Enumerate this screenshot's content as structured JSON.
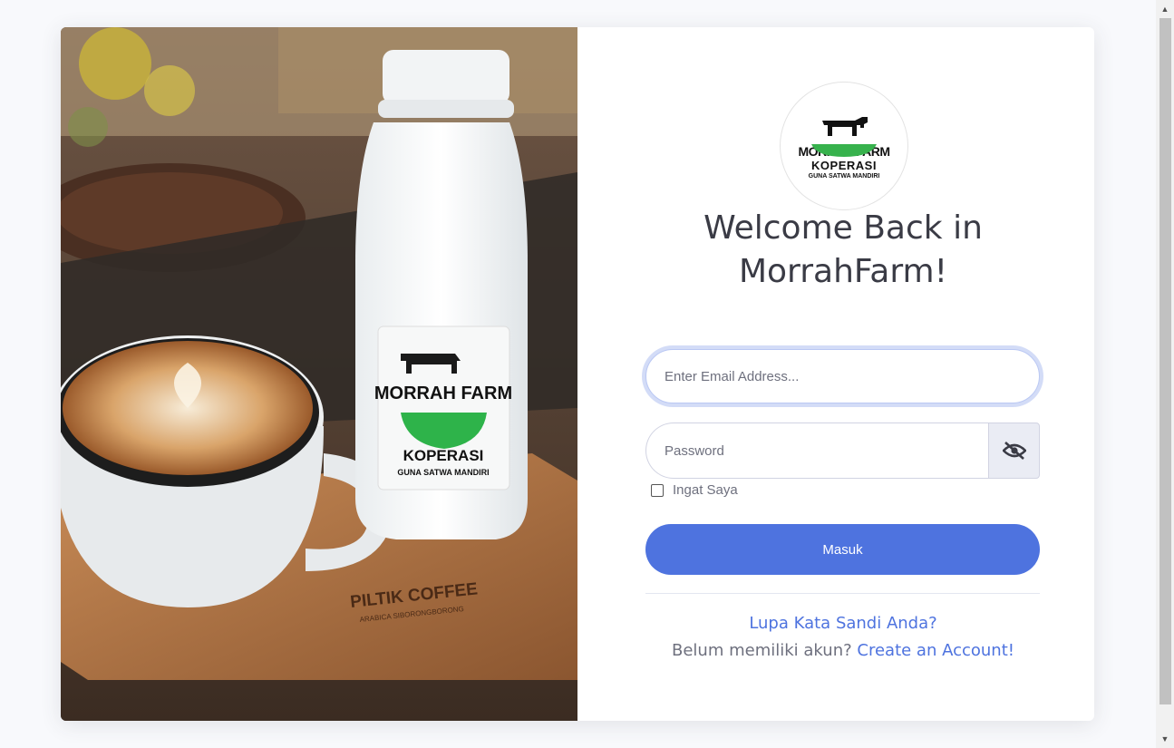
{
  "hero": {
    "image_alt": "Morrah Farm milk bottle with cappuccino",
    "bottle_brand": "MORRAH FARM",
    "bottle_sub1": "KOPERASI",
    "bottle_sub2": "GUNA SATWA MANDIRI",
    "tray_brand": "PILTIK COFFEE",
    "tray_sub": "ARABICA SIBORONGBORONG"
  },
  "logo": {
    "brand": "MORRAH FARM",
    "sub1": "KOPERASI",
    "sub2": "GUNA SATWA MANDIRI"
  },
  "heading": {
    "line1": "Welcome Back in",
    "line2": "MorrahFarm!"
  },
  "form": {
    "email_placeholder": "Enter Email Address...",
    "password_placeholder": "Password",
    "remember_label": "Ingat Saya",
    "submit_label": "Masuk"
  },
  "links": {
    "forgot": "Lupa Kata Sandi Anda?",
    "signup_prefix": "Belum memiliki akun?",
    "signup_link": "Create an Account!"
  },
  "colors": {
    "primary": "#4e73df",
    "text": "#3a3b45",
    "muted": "#6e707e"
  }
}
